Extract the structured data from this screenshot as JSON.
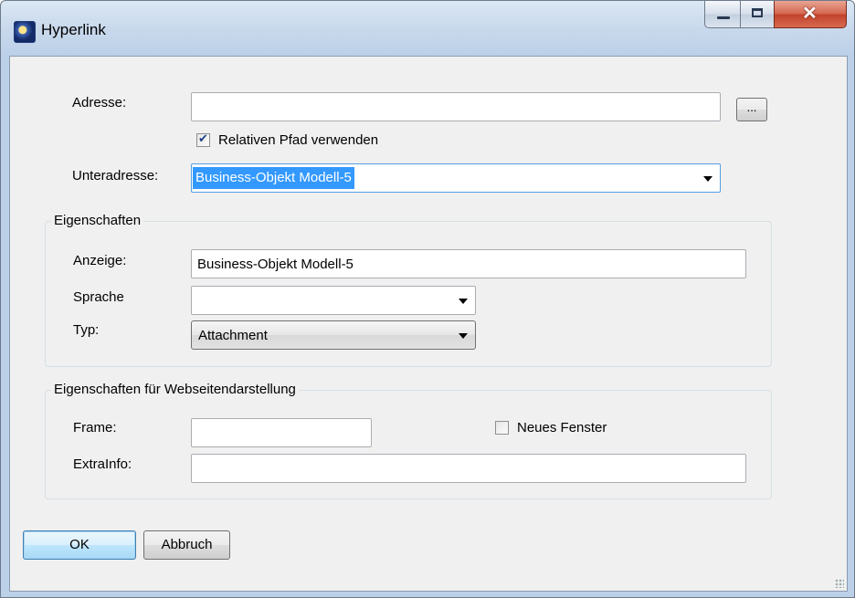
{
  "window": {
    "title": "Hyperlink"
  },
  "address": {
    "label": "Adresse:",
    "value": "",
    "browse_label": "...",
    "relative_path_label": "Relativen Pfad verwenden",
    "relative_path_checked": true
  },
  "subaddress": {
    "label": "Unteradresse:",
    "value": "Business-Objekt Modell-5"
  },
  "properties": {
    "title": "Eigenschaften",
    "display_label": "Anzeige:",
    "display_value": "Business-Objekt Modell-5",
    "language_label": "Sprache",
    "language_value": "",
    "type_label": "Typ:",
    "type_value": "Attachment"
  },
  "web": {
    "title": "Eigenschaften für Webseitendarstellung",
    "frame_label": "Frame:",
    "frame_value": "",
    "new_window_label": "Neues Fenster",
    "new_window_checked": false,
    "extrainfo_label": "ExtraInfo:",
    "extrainfo_value": ""
  },
  "buttons": {
    "ok": "OK",
    "cancel": "Abbruch"
  }
}
